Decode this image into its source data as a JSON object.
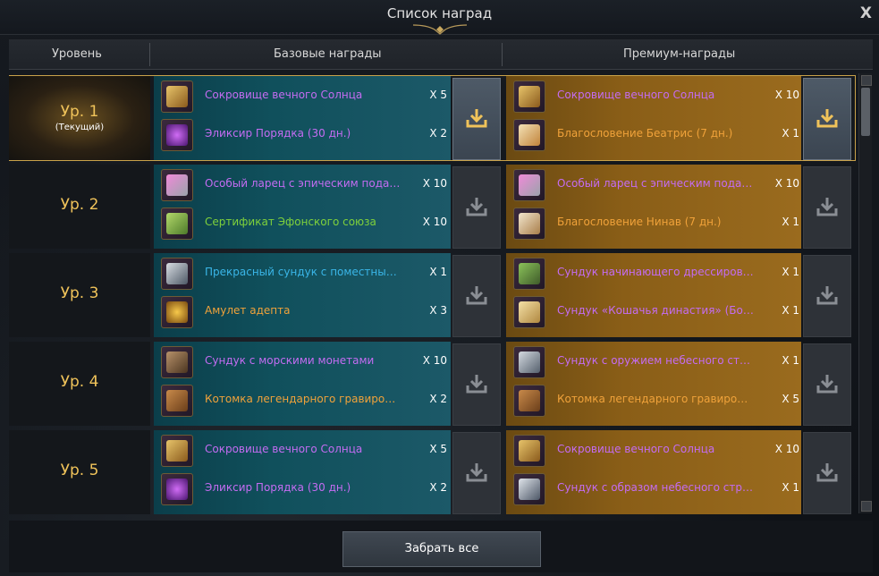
{
  "window": {
    "title": "Список наград",
    "close": "X"
  },
  "headers": {
    "level": "Уровень",
    "basic": "Базовые награды",
    "premium": "Премиум-награды"
  },
  "current_label": "(Текущий)",
  "colors": {
    "purple_item": "#c46cf2",
    "blue_item": "#3ab6e8",
    "green_item": "#7fd13b",
    "orange_item": "#f0a23a",
    "level_gold": "#f0c35a"
  },
  "rows": [
    {
      "level": "Ур. 1",
      "current": true,
      "basic": [
        {
          "name": "Сокровище вечного Солнца",
          "qty": "X 5",
          "color": "#c46cf2",
          "icon": "golden-chest-icon"
        },
        {
          "name": "Эликсир Порядка (30 дн.)",
          "qty": "X 2",
          "color": "#c46cf2",
          "icon": "purple-elixir-icon"
        }
      ],
      "premium": [
        {
          "name": "Сокровище вечного Солнца",
          "qty": "X 10",
          "color": "#c46cf2",
          "icon": "golden-chest-icon"
        },
        {
          "name": "Благословение Беатрис (7 дн.)",
          "qty": "X 1",
          "color": "#f0a23a",
          "icon": "wings-icon"
        }
      ]
    },
    {
      "level": "Ур. 2",
      "current": false,
      "basic": [
        {
          "name": "Особый ларец с эпическим подарком",
          "qty": "X 10",
          "color": "#c46cf2",
          "icon": "gift-chest-icon"
        },
        {
          "name": "Сертификат Эфонского союза",
          "qty": "X 10",
          "color": "#7fd13b",
          "icon": "certificate-icon"
        }
      ],
      "premium": [
        {
          "name": "Особый ларец с эпическим подарком",
          "qty": "X 10",
          "color": "#c46cf2",
          "icon": "gift-chest-icon"
        },
        {
          "name": "Благословение Нинав (7 дн.)",
          "qty": "X 1",
          "color": "#f0a23a",
          "icon": "feather-icon"
        }
      ]
    },
    {
      "level": "Ур. 3",
      "current": false,
      "basic": [
        {
          "name": "Прекрасный сундук с поместными материалами",
          "qty": "X 1",
          "color": "#3ab6e8",
          "icon": "silver-chest-icon"
        },
        {
          "name": "Амулет адепта",
          "qty": "X 3",
          "color": "#f0a23a",
          "icon": "amulet-icon"
        }
      ],
      "premium": [
        {
          "name": "Сундук начинающего дрессировщика",
          "qty": "X 1",
          "color": "#c46cf2",
          "icon": "green-chest-icon"
        },
        {
          "name": "Сундук «Кошачья династия» (Боевой)",
          "qty": "X 1",
          "color": "#c46cf2",
          "icon": "cat-chest-icon"
        }
      ]
    },
    {
      "level": "Ур. 4",
      "current": false,
      "basic": [
        {
          "name": "Сундук с морскими монетами",
          "qty": "X 10",
          "color": "#c46cf2",
          "icon": "sea-chest-icon"
        },
        {
          "name": "Котомка легендарного гравировщика",
          "qty": "X 2",
          "color": "#f0a23a",
          "icon": "satchel-icon"
        }
      ],
      "premium": [
        {
          "name": "Сундук с оружием небесного стража",
          "qty": "X 1",
          "color": "#c46cf2",
          "icon": "weapon-chest-icon"
        },
        {
          "name": "Котомка легендарного гравировщика",
          "qty": "X 5",
          "color": "#f0a23a",
          "icon": "satchel-icon"
        }
      ]
    },
    {
      "level": "Ур. 5",
      "current": false,
      "basic": [
        {
          "name": "Сокровище вечного Солнца",
          "qty": "X 5",
          "color": "#c46cf2",
          "icon": "golden-chest-icon"
        },
        {
          "name": "Эликсир Порядка (30 дн.)",
          "qty": "X 2",
          "color": "#c46cf2",
          "icon": "purple-elixir-icon"
        }
      ],
      "premium": [
        {
          "name": "Сокровище вечного Солнца",
          "qty": "X 10",
          "color": "#c46cf2",
          "icon": "golden-chest-icon"
        },
        {
          "name": "Сундук с образом небесного стража",
          "qty": "X 1",
          "color": "#c46cf2",
          "icon": "outfit-chest-icon"
        }
      ]
    }
  ],
  "footer": {
    "claim_all": "Забрать все"
  }
}
